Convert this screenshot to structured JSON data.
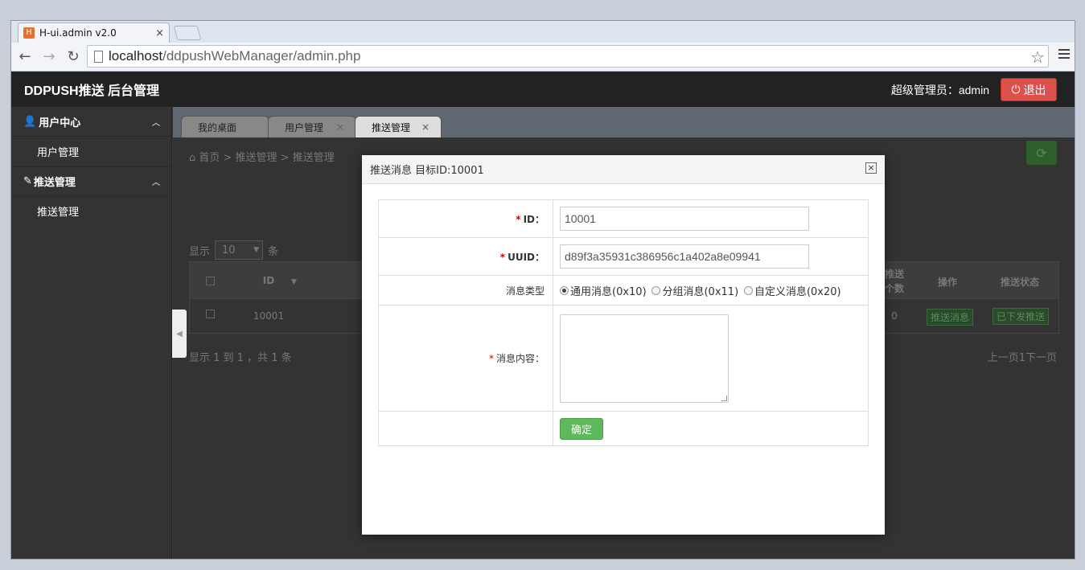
{
  "browser": {
    "tab_title": "H-ui.admin v2.0",
    "tab_close": "×",
    "url_host": "localhost",
    "url_path": "/ddpushWebManager/admin.php"
  },
  "header": {
    "logo": "DDPUSH推送 后台管理",
    "admin_label": "超级管理员：admin",
    "logout_label": "退出"
  },
  "sidebar": {
    "groups": [
      {
        "title": "用户中心",
        "items": [
          "用户管理"
        ]
      },
      {
        "title": "推送管理",
        "items": [
          "推送管理"
        ]
      }
    ]
  },
  "page_tabs": [
    {
      "label": "我的桌面"
    },
    {
      "label": "用户管理"
    },
    {
      "label": "推送管理",
      "active": true
    }
  ],
  "breadcrumb": "首页  >  推送管理  >  推送管理",
  "list": {
    "show_prefix": "显示",
    "page_size": "10",
    "show_suffix": "条",
    "col_id": "ID",
    "col_push_count": "推送个数",
    "col_action": "操作",
    "col_status": "推送状态",
    "row_id": "10001",
    "row_count": "0",
    "row_action": "推送消息",
    "row_status": "已下发推送",
    "info": "显示 1 到 1 ，共 1 条",
    "pager": "上一页1下一页"
  },
  "modal": {
    "title": "推送消息 目标ID:10001",
    "id_label": "ID：",
    "id_value": "10001",
    "uuid_label": "UUID：",
    "uuid_value": "d89f3a35931c386956c1a402a8e09941",
    "type_label": "消息类型",
    "type_options": [
      "通用消息(0x10)",
      "分组消息(0x11)",
      "自定义消息(0x20)"
    ],
    "type_selected": 0,
    "content_label": "消息内容：",
    "submit_label": "确定"
  },
  "colors": {
    "header_bg": "#222222",
    "logout_red": "#dd514c",
    "submit_green": "#5eb95e",
    "required_red": "#cc0000"
  }
}
